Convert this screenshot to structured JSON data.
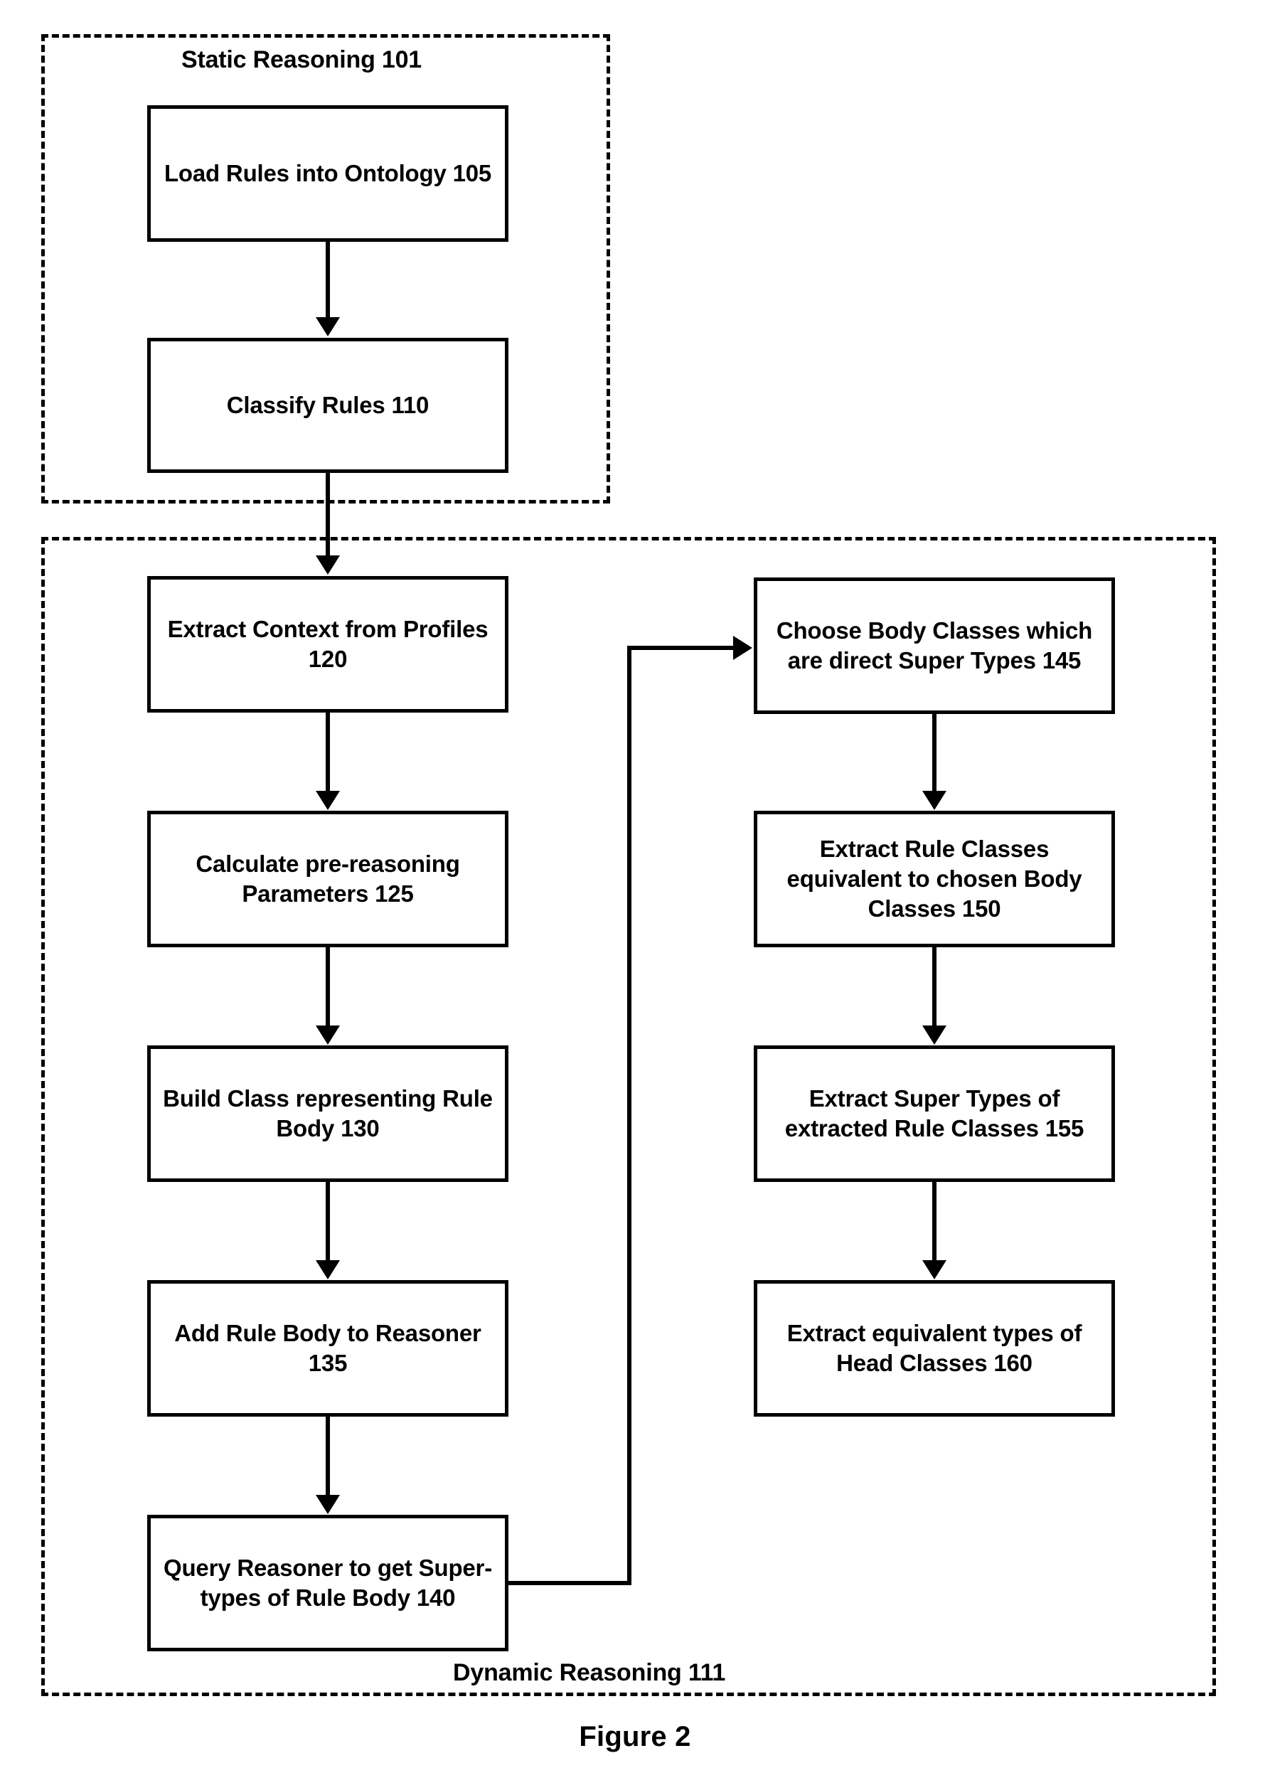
{
  "figure": {
    "caption": "Figure 2"
  },
  "groups": {
    "static": {
      "label": "Static Reasoning 101"
    },
    "dynamic": {
      "label": "Dynamic Reasoning 111"
    }
  },
  "nodes": {
    "n105": {
      "label": "Load Rules into Ontology 105"
    },
    "n110": {
      "label": "Classify Rules 110"
    },
    "n120": {
      "label": "Extract Context from Profiles 120"
    },
    "n125": {
      "label": "Calculate pre-reasoning Parameters 125"
    },
    "n130": {
      "label": "Build Class representing Rule Body 130"
    },
    "n135": {
      "label": "Add Rule Body to Reasoner 135"
    },
    "n140": {
      "label": "Query Reasoner to get Super-types of Rule Body 140"
    },
    "n145": {
      "label": "Choose Body Classes which are direct Super Types 145"
    },
    "n150": {
      "label": "Extract Rule Classes equivalent to chosen Body Classes 150"
    },
    "n155": {
      "label": "Extract Super Types of extracted Rule Classes 155"
    },
    "n160": {
      "label": "Extract equivalent types of Head Classes 160"
    }
  },
  "chart_data": {
    "type": "diagram",
    "title": "Figure 2",
    "diagram_kind": "flowchart",
    "groups": [
      {
        "id": "101",
        "label": "Static Reasoning 101",
        "members": [
          "105",
          "110"
        ]
      },
      {
        "id": "111",
        "label": "Dynamic Reasoning 111",
        "members": [
          "120",
          "125",
          "130",
          "135",
          "140",
          "145",
          "150",
          "155",
          "160"
        ]
      }
    ],
    "nodes": [
      {
        "id": "105",
        "label": "Load Rules into Ontology 105",
        "column": "left"
      },
      {
        "id": "110",
        "label": "Classify Rules 110",
        "column": "left"
      },
      {
        "id": "120",
        "label": "Extract Context from Profiles 120",
        "column": "left"
      },
      {
        "id": "125",
        "label": "Calculate pre-reasoning Parameters 125",
        "column": "left"
      },
      {
        "id": "130",
        "label": "Build Class representing Rule Body 130",
        "column": "left"
      },
      {
        "id": "135",
        "label": "Add Rule Body to Reasoner 135",
        "column": "left"
      },
      {
        "id": "140",
        "label": "Query Reasoner to get Super-types of Rule Body 140",
        "column": "left"
      },
      {
        "id": "145",
        "label": "Choose Body Classes which are direct Super Types 145",
        "column": "right"
      },
      {
        "id": "150",
        "label": "Extract Rule Classes equivalent to chosen Body Classes 150",
        "column": "right"
      },
      {
        "id": "155",
        "label": "Extract Super Types of extracted Rule Classes 155",
        "column": "right"
      },
      {
        "id": "160",
        "label": "Extract equivalent types of Head Classes 160",
        "column": "right"
      }
    ],
    "edges": [
      {
        "from": "105",
        "to": "110"
      },
      {
        "from": "110",
        "to": "120"
      },
      {
        "from": "120",
        "to": "125"
      },
      {
        "from": "125",
        "to": "130"
      },
      {
        "from": "130",
        "to": "135"
      },
      {
        "from": "135",
        "to": "140"
      },
      {
        "from": "140",
        "to": "145"
      },
      {
        "from": "145",
        "to": "150"
      },
      {
        "from": "150",
        "to": "155"
      },
      {
        "from": "155",
        "to": "160"
      }
    ],
    "colors": {
      "stroke": "#000000",
      "fill": "#ffffff",
      "text": "#000000"
    }
  }
}
